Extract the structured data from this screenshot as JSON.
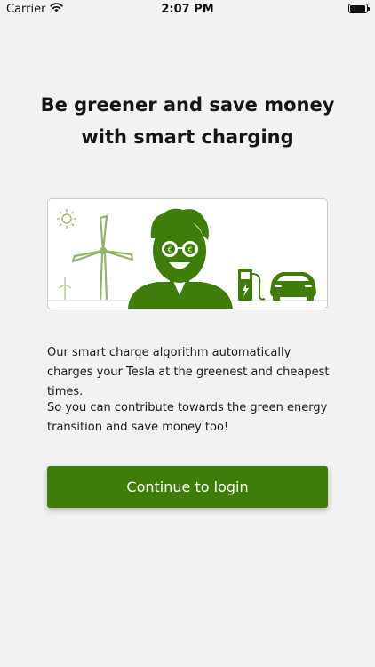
{
  "status_bar": {
    "carrier": "Carrier",
    "time": "2:07 PM"
  },
  "headline": "Be greener and save money with smart charging",
  "illustration": {
    "icons": [
      "sun-icon",
      "wind-turbine-icon",
      "person-face-icon",
      "ev-charger-icon",
      "car-icon"
    ],
    "accent_color": "#3f7d0a",
    "light_color": "#8fb46b"
  },
  "body": {
    "paragraph1": "Our smart charge algorithm automatically charges your Tesla at the greenest and cheapest times.",
    "paragraph2": "So you can contribute towards the green energy transition and save money too!"
  },
  "continue_button": {
    "label": "Continue to login",
    "color": "#3f7d0a"
  }
}
